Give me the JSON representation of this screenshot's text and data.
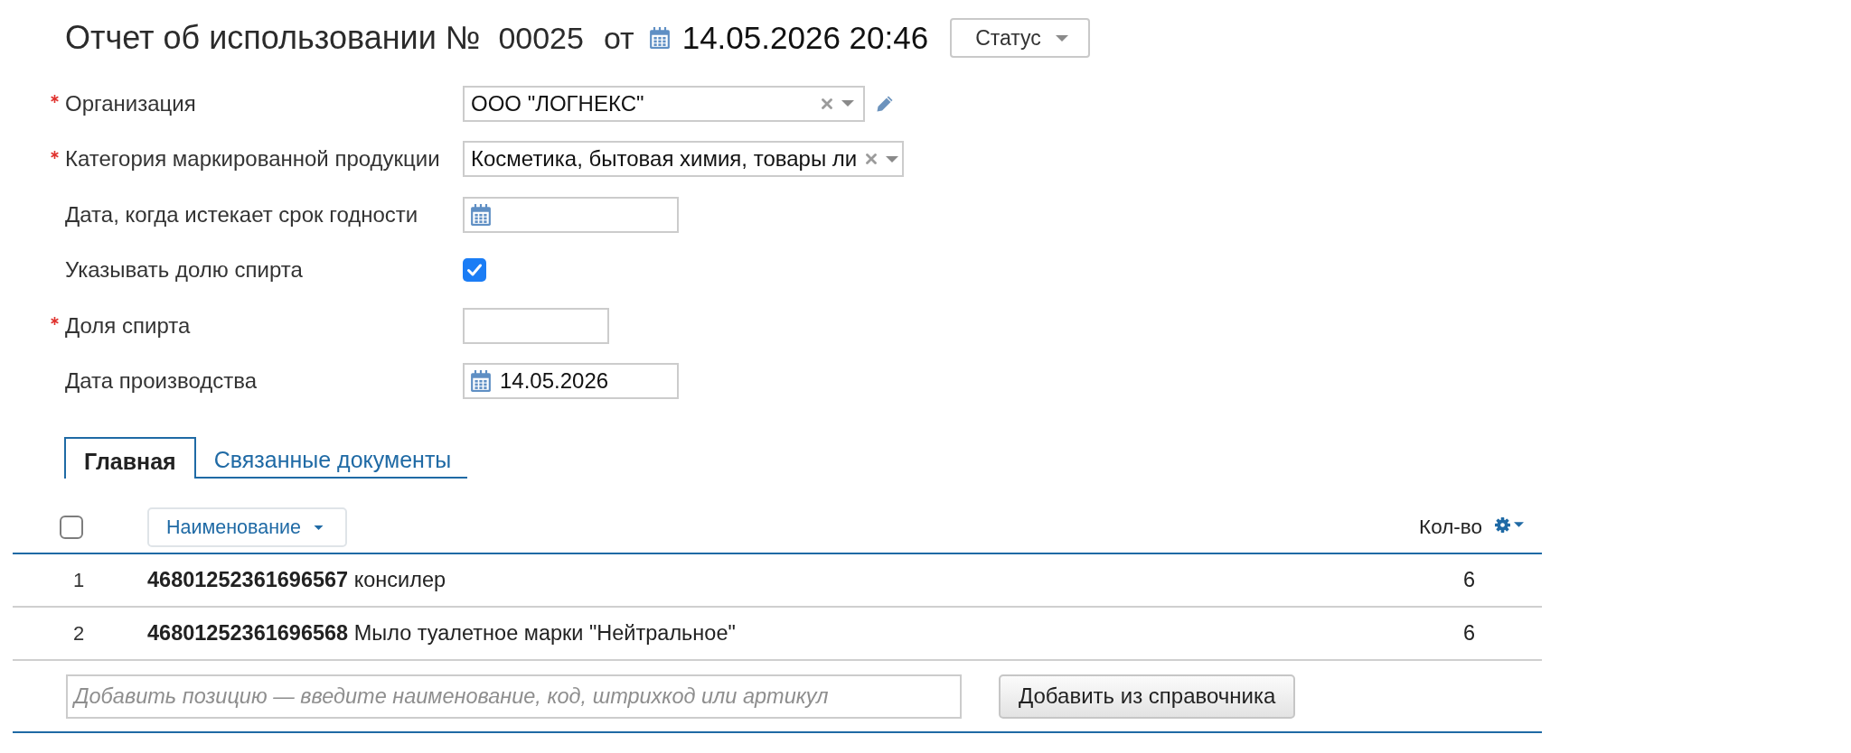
{
  "header": {
    "title": "Отчет об использовании №",
    "number": "00025",
    "date_prefix": "от",
    "date": "14.05.2026 20:46",
    "status_button": "Статус"
  },
  "form": {
    "fields": [
      {
        "kind": "select",
        "label": "Организация",
        "required": true,
        "value": "ООО \"ЛОГНЕКС\"",
        "editable": true
      },
      {
        "kind": "select",
        "label": "Категория маркированной продукции",
        "required": true,
        "value": "Косметика, бытовая химия, товары ли",
        "editable": false
      },
      {
        "kind": "date",
        "label": "Дата, когда истекает срок годности",
        "required": false
      },
      {
        "kind": "checkbox",
        "label": "Указывать долю спирта",
        "required": false,
        "checked": true
      },
      {
        "kind": "text",
        "label": "Доля спирта",
        "required": true
      },
      {
        "kind": "date",
        "label": "Дата производства",
        "required": false,
        "value": "14.05.2026"
      }
    ]
  },
  "tabs": [
    {
      "label": "Главная",
      "selected": true
    },
    {
      "label": "Связанные документы",
      "selected": false
    }
  ],
  "table": {
    "select_all": {
      "checked": false
    },
    "columns": [
      {
        "kind": "name",
        "label": "Наименование"
      },
      {
        "kind": "quantity",
        "label": "Кол-во"
      }
    ],
    "rows": [
      {
        "number": "1",
        "item": "**46801252361696567** консилер",
        "quantity": "6"
      },
      {
        "number": "2",
        "item": "**46801252361696568** Мыло туалетное марки \"Нейтральное\"",
        "quantity": "6"
      }
    ]
  },
  "add_row": {
    "placeholder": "Добавить позицию — введите наименование, код, штрихкод или артикул",
    "button": "Добавить из справочника"
  }
}
